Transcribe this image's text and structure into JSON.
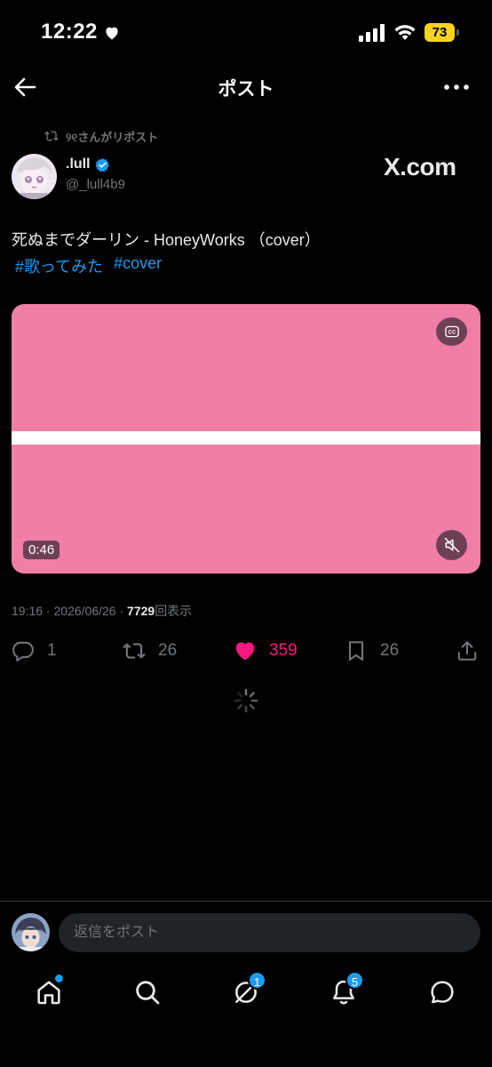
{
  "status_bar": {
    "time": "12:22",
    "battery": "73"
  },
  "header": {
    "title": "ポスト"
  },
  "repost": {
    "text": "୨୧さんがリポスト"
  },
  "author": {
    "name": ".lull",
    "handle": "@_lull4b9",
    "watermark": "X.com"
  },
  "post": {
    "text": "死ぬまでダーリン - HoneyWorks （cover）",
    "hashtags": [
      "#歌ってみた",
      "#cover"
    ]
  },
  "media": {
    "duration": "0:46",
    "background": "#f17ea6"
  },
  "meta": {
    "time": "19:16",
    "date": "2026/06/26",
    "views": "7729",
    "views_label": "回表示"
  },
  "actions": {
    "replies": "1",
    "reposts": "26",
    "likes": "359",
    "bookmarks": "26"
  },
  "reply": {
    "placeholder": "返信をポスト"
  },
  "tabbar": {
    "grok_badge": "1",
    "notifications_badge": "5"
  },
  "colors": {
    "accent": "#1d9bf0",
    "like": "#f91880",
    "muted": "#71767b",
    "battery": "#f5d320"
  }
}
